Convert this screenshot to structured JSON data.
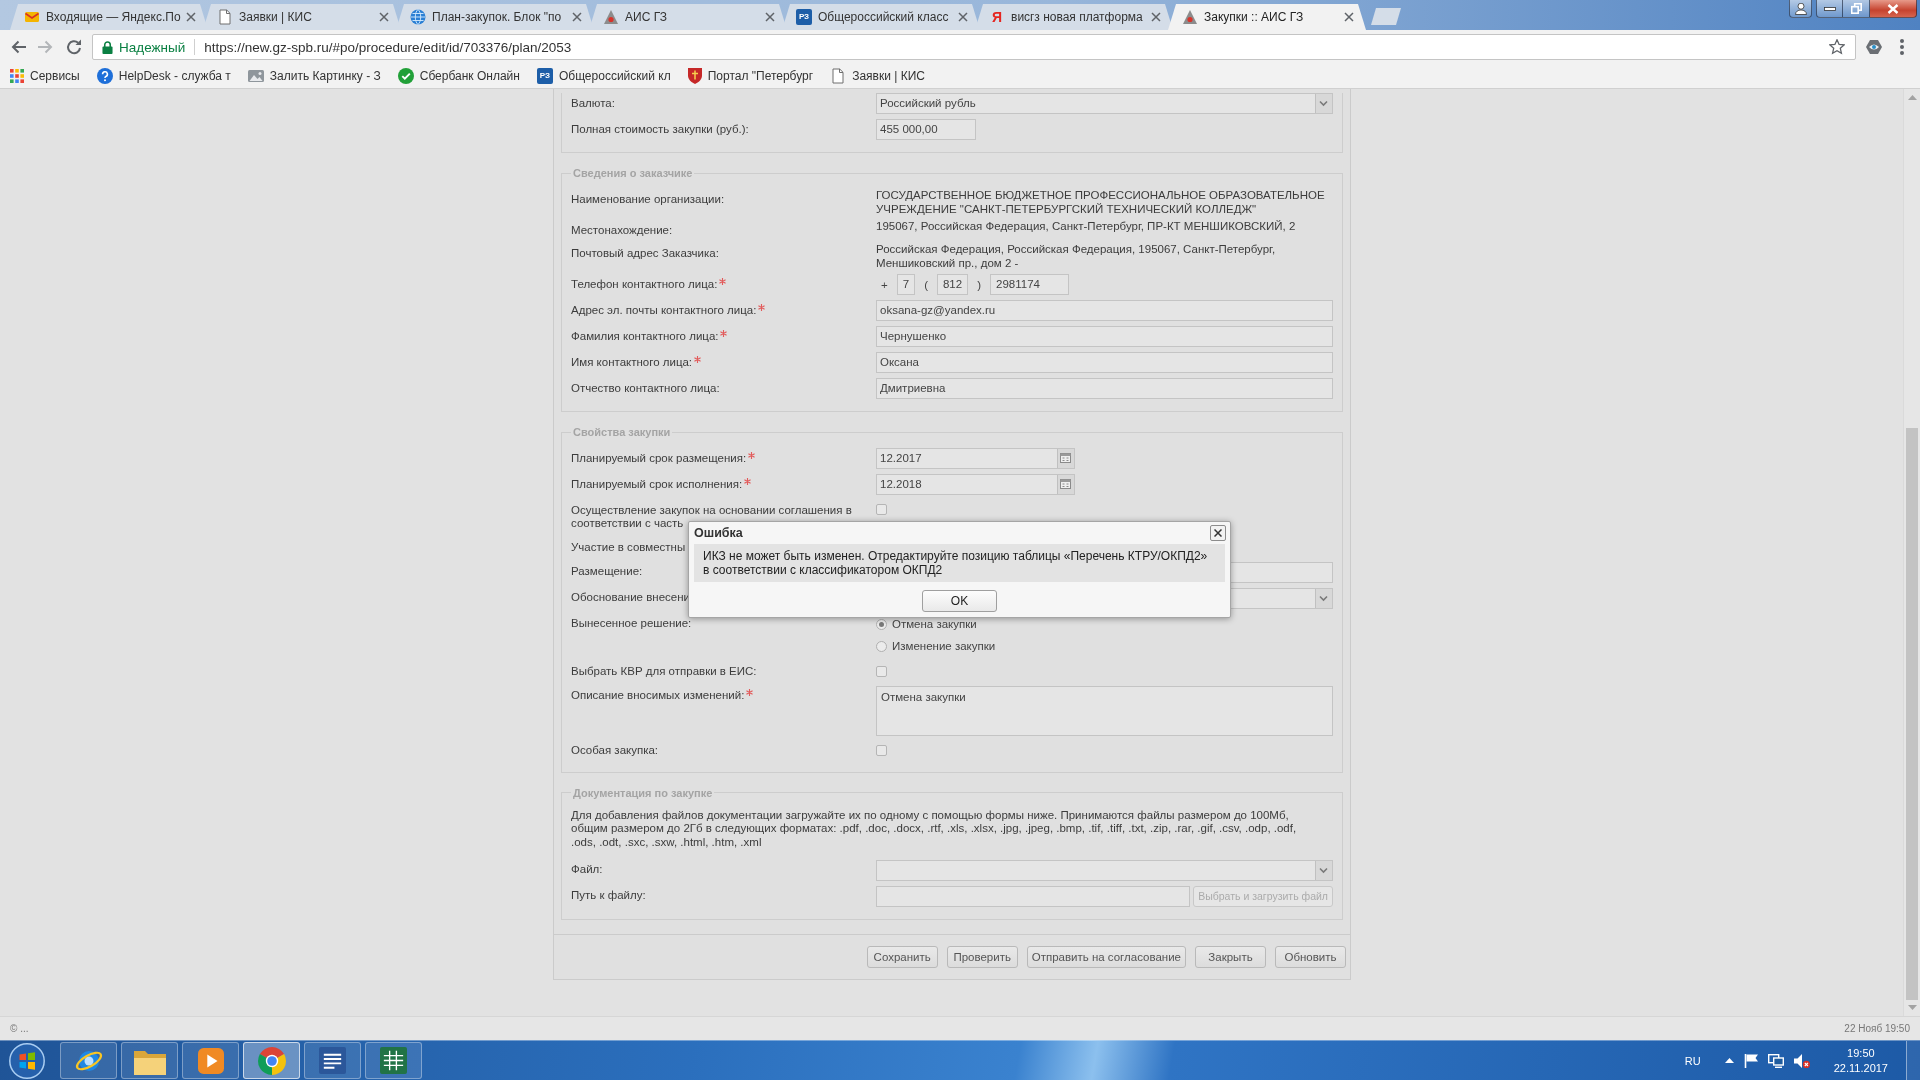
{
  "browser": {
    "tabs": [
      {
        "title": "Входящие — Яндекс.По",
        "selected": false
      },
      {
        "title": "Заявки | КИС",
        "selected": false
      },
      {
        "title": "План-закупок. Блок \"по",
        "selected": false
      },
      {
        "title": "АИС ГЗ",
        "selected": false
      },
      {
        "title": "Общероссийский класс",
        "logo": "РЗ",
        "selected": false
      },
      {
        "title": "висгз новая платформа",
        "logo": "Я",
        "selected": false
      },
      {
        "title": "Закупки :: АИС ГЗ",
        "selected": true
      }
    ],
    "address_bar": {
      "security_label": "Надежный",
      "url": "https://new.gz-spb.ru/#po/procedure/edit/id/703376/plan/2053"
    },
    "bookmarks": [
      {
        "label": "Сервисы"
      },
      {
        "label": "HelpDesk - служба т"
      },
      {
        "label": "Залить Картинку - З"
      },
      {
        "label": "Сбербанк Онлайн"
      },
      {
        "label": "Общероссийский кл",
        "logo": "РЗ"
      },
      {
        "label": "Портал \"Петербург"
      },
      {
        "label": "Заявки | КИС"
      }
    ]
  },
  "form": {
    "sections": [
      {
        "rows": [
          {
            "kind": "select",
            "label": "Валюта:",
            "required": false,
            "value": "Российский рубль"
          },
          {
            "kind": "amount",
            "label": "Полная стоимость закупки (руб.):",
            "required": false,
            "value": "455 000,00"
          }
        ]
      },
      {
        "legend": "Сведения о заказчике",
        "rows": [
          {
            "kind": "text",
            "label": "Наименование организации:",
            "required": false,
            "value": "ГОСУДАРСТВЕННОЕ БЮДЖЕТНОЕ ПРОФЕССИОНАЛЬНОЕ ОБРАЗОВАТЕЛЬНОЕ УЧРЕЖДЕНИЕ \"САНКТ-ПЕТЕРБУРГСКИЙ ТЕХНИЧЕСКИЙ КОЛЛЕДЖ\""
          },
          {
            "kind": "text",
            "label": "Местонахождение:",
            "required": false,
            "value": "195067, Российская Федерация, Санкт-Петербург, ПР-КТ МЕНШИКОВСКИЙ, 2"
          },
          {
            "kind": "text",
            "label": "Почтовый адрес Заказчика:",
            "required": false,
            "value": "Российская Федерация, Российская Федерация, 195067, Санкт-Петербург, Меншиковский пр., дом 2 -"
          },
          {
            "kind": "phone",
            "label": "Телефон контактного лица:",
            "required": true,
            "parts": [
              {
                "kind": "text",
                "text": "+"
              },
              {
                "kind": "input",
                "value": "7"
              },
              {
                "kind": "text",
                "text": "("
              },
              {
                "kind": "input",
                "value": "812"
              },
              {
                "kind": "text",
                "text": ")"
              },
              {
                "kind": "input",
                "value": "2981174"
              }
            ]
          },
          {
            "kind": "input",
            "label": "Адрес эл. почты контактного лица:",
            "required": true,
            "value": "oksana-gz@yandex.ru"
          },
          {
            "kind": "input",
            "label": "Фамилия контактного лица:",
            "required": true,
            "value": "Чернушенко"
          },
          {
            "kind": "input",
            "label": "Имя контактного лица:",
            "required": true,
            "value": "Оксана"
          },
          {
            "kind": "input",
            "label": "Отчество контактного лица:",
            "required": false,
            "value": "Дмитриевна"
          }
        ]
      },
      {
        "legend": "Свойства закупки",
        "rows": [
          {
            "kind": "date",
            "label": "Планируемый срок размещения:",
            "required": true,
            "value": "12.2017"
          },
          {
            "kind": "date",
            "label": "Планируемый срок исполнения:",
            "required": true,
            "value": "12.2018"
          },
          {
            "kind": "checkbox",
            "label": "Осуществление закупок на основании соглашения в соответствии с часть",
            "required": false,
            "checked": false
          },
          {
            "kind": "blank",
            "label": "Участие в совместны",
            "required": false
          },
          {
            "kind": "input",
            "label": "Размещение:",
            "required": false
          },
          {
            "kind": "select",
            "label": "Обоснование внесени",
            "required": false
          },
          {
            "kind": "radio",
            "label": "Вынесенное решение:",
            "required": false,
            "options": [
              {
                "label": "Отмена закупки",
                "selected": true
              },
              {
                "label": "Изменение закупки",
                "selected": false
              }
            ]
          },
          {
            "kind": "checkbox",
            "label": "Выбрать КВР для отправки в ЕИС:",
            "required": false,
            "checked": false
          },
          {
            "kind": "textarea",
            "label": "Описание вносимых изменений:",
            "required": true,
            "value": "Отмена закупки"
          },
          {
            "kind": "checkbox",
            "label": "Особая закупка:",
            "required": false,
            "checked": false
          }
        ]
      },
      {
        "legend": "Документация по закупке",
        "note": "Для добавления файлов документации загружайте их по одному с помощью формы ниже. Принимаются файлы размером до 100Мб, общим размером до 2Гб в следующих форматах: .pdf, .doc, .docx, .rtf, .xls, .xlsx, .jpg, .jpeg, .bmp, .tif, .tiff, .txt, .zip, .rar, .gif, .csv, .odp, .odf, .ods, .odt, .sxc, .sxw, .html, .htm, .xml",
        "rows": [
          {
            "kind": "select",
            "label": "Файл:",
            "required": false
          },
          {
            "kind": "upload",
            "label": "Путь к файлу:",
            "required": false,
            "button": {
              "label": "Выбрать и загрузить файл",
              "disabled": true
            }
          }
        ]
      }
    ],
    "actions": [
      {
        "label": "Сохранить"
      },
      {
        "label": "Проверить"
      },
      {
        "label": "Отправить на согласование"
      },
      {
        "label": "Закрыть"
      },
      {
        "label": "Обновить"
      }
    ]
  },
  "dialog": {
    "title": "Ошибка",
    "message": "ИКЗ не может быть изменен. Отредактируйте позицию таблицы «Перечень КТРУ/ОКПД2» в соответствии с классификатором ОКПД2",
    "button": "OK"
  },
  "status_bar": {
    "left": "© ...",
    "right": "22 Нояб 19:50"
  },
  "taskbar": {
    "apps": [
      {
        "selected": false
      },
      {
        "selected": false
      },
      {
        "selected": false
      },
      {
        "selected": true
      },
      {
        "selected": false
      },
      {
        "selected": false
      }
    ],
    "tray": {
      "language": "RU",
      "time": "19:50",
      "date": "22.11.2017"
    }
  }
}
